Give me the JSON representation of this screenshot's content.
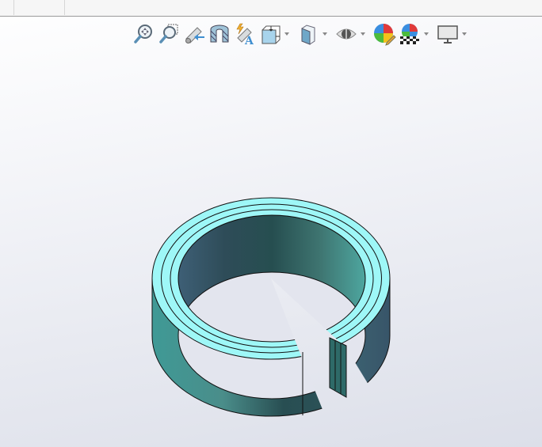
{
  "toolbar": {
    "items": [
      "zoom-to-fit",
      "zoom-to-area",
      "previous-view",
      "section-view",
      "dynamic-annotation-views",
      "view-orientation",
      "display-style",
      "hide-show-items",
      "edit-appearance",
      "apply-scene",
      "view-settings"
    ]
  },
  "model": {
    "face_color": "#9ef7f7",
    "wall_dark": "#2a5458",
    "wall_light": "#4a9a98",
    "edge_color": "#111111"
  }
}
